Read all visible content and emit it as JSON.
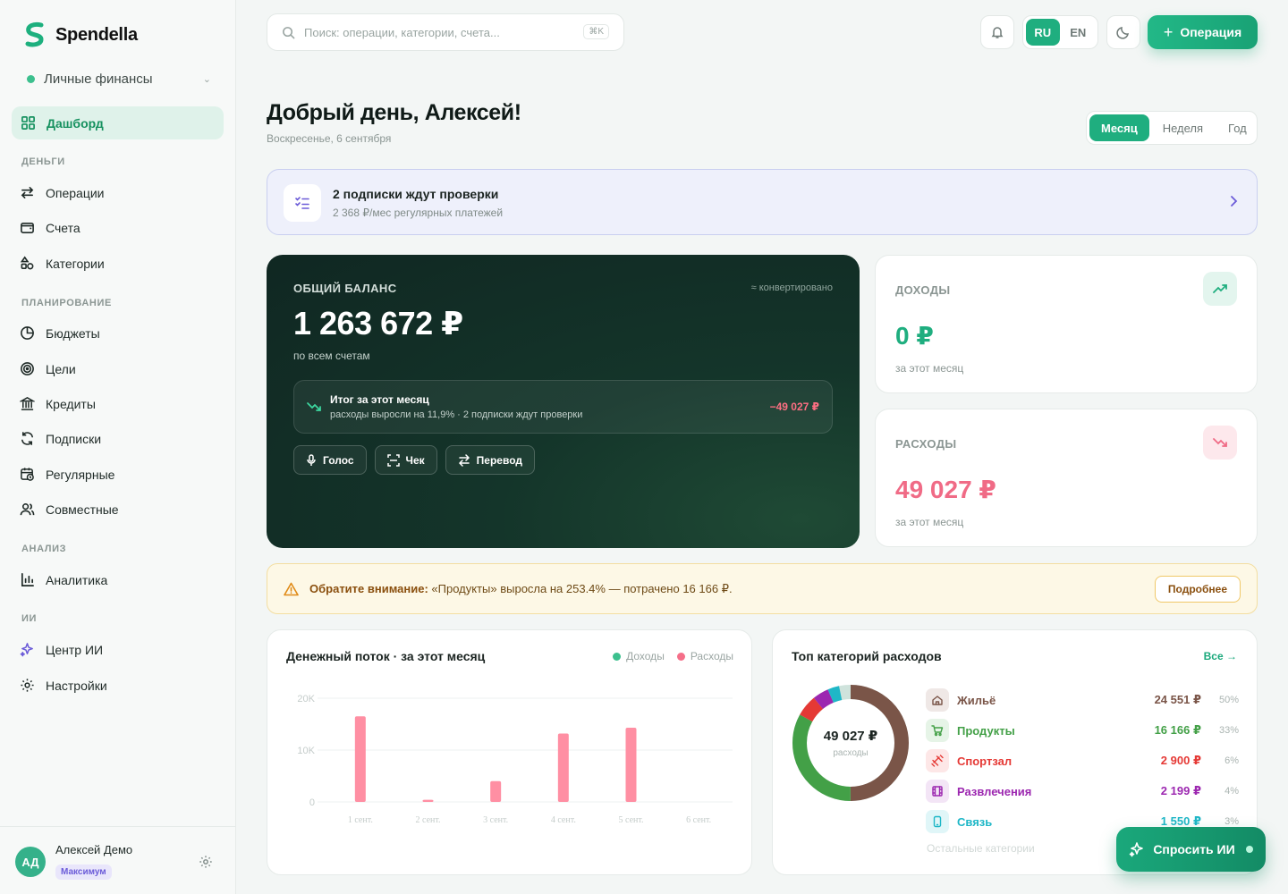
{
  "app": {
    "name": "Spendella",
    "brand_color": "#1fae7f"
  },
  "workspace": {
    "label": "Личные финансы"
  },
  "nav": {
    "dashboard": "Дашборд",
    "sections": {
      "money": "ДЕНЬГИ",
      "planning": "ПЛАНИРОВАНИЕ",
      "analysis": "АНАЛИЗ",
      "ai": "ИИ"
    },
    "items": {
      "operations": "Операции",
      "accounts": "Счета",
      "categories": "Категории",
      "budgets": "Бюджеты",
      "goals": "Цели",
      "credits": "Кредиты",
      "subscriptions": "Подписки",
      "recurring": "Регулярные",
      "shared": "Совместные",
      "analytics": "Аналитика",
      "ai_center": "Центр ИИ",
      "settings": "Настройки"
    }
  },
  "user": {
    "initials": "АД",
    "name": "Алексей Демо",
    "plan": "Максимум"
  },
  "topbar": {
    "search_placeholder": "Поиск: операции, категории, счета...",
    "search_shortcut": "⌘K",
    "lang_ru": "RU",
    "lang_en": "EN",
    "operation_button": "Операция"
  },
  "greeting": {
    "title": "Добрый день, Алексей!",
    "date": "Воскресенье, 6 сентября"
  },
  "period": {
    "month": "Месяц",
    "week": "Неделя",
    "year": "Год",
    "selected": "month"
  },
  "subs_banner": {
    "title": "2 подписки ждут проверки",
    "subtitle": "2 368 ₽/мес регулярных платежей"
  },
  "balance": {
    "label": "ОБЩИЙ БАЛАНС",
    "converted": "≈ конвертировано",
    "value": "1 263 672 ₽",
    "subtitle": "по всем счетам",
    "month_title": "Итог за этот месяц",
    "month_subtitle": "расходы выросли на 11,9% · 2 подписки ждут проверки",
    "month_value": "−49 027 ₽",
    "actions": {
      "voice": "Голос",
      "receipt": "Чек",
      "transfer": "Перевод"
    }
  },
  "income": {
    "label": "ДОХОДЫ",
    "value": "0 ₽",
    "subtitle": "за этот месяц",
    "color": "#1fae7f"
  },
  "expenses": {
    "label": "РАСХОДЫ",
    "value": "49 027 ₽",
    "subtitle": "за этот месяц",
    "color": "#f06b86"
  },
  "alert": {
    "bold": "Обратите внимание:",
    "text": " «Продукты» выросла на 253.4% — потрачено 16 166 ₽.",
    "button": "Подробнее"
  },
  "cashflow": {
    "title": "Денежный поток · за этот месяц",
    "legend_income": "Доходы",
    "legend_expense": "Расходы",
    "income_color": "#3cc08e",
    "expense_color": "#f56f89"
  },
  "chart_data": {
    "type": "bar",
    "title": "Денежный поток · за этот месяц",
    "x": [
      "1 сент.",
      "1.5",
      "2 сент.",
      "2.5",
      "3 сент.",
      "3.5",
      "4 сент.",
      "4.5",
      "5 сент.",
      "5.5",
      "6 сент."
    ],
    "x_tick_labels": [
      "1 сент.",
      "2 сент.",
      "3 сент.",
      "4 сент.",
      "5 сент.",
      "6 сент."
    ],
    "y_tick_labels": [
      "20K",
      "10K",
      "0"
    ],
    "ylim": [
      0,
      20000
    ],
    "grid": true,
    "series": [
      {
        "name": "Расходы",
        "color": "#ff8fa3",
        "points": [
          [
            1,
            16500
          ],
          [
            2,
            400
          ],
          [
            3,
            4000
          ],
          [
            4,
            13200
          ],
          [
            5,
            14300
          ]
        ]
      },
      {
        "name": "Доходы",
        "color": "#3cc08e",
        "points": []
      }
    ]
  },
  "top_categories": {
    "title": "Топ категорий расходов",
    "all_link": "Все →",
    "total": "49 027 ₽",
    "total_label": "расходы",
    "more": "Остальные категории",
    "items": [
      {
        "name": "Жильё",
        "amount": "24 551 ₽",
        "pct": "50%",
        "share": 0.5,
        "color": "#7a5548",
        "bg": "#efe8e6",
        "icon": "home-icon"
      },
      {
        "name": "Продукты",
        "amount": "16 166 ₽",
        "pct": "33%",
        "share": 0.33,
        "color": "#43a047",
        "bg": "#e6f4e7",
        "icon": "cart-icon"
      },
      {
        "name": "Спортзал",
        "amount": "2 900 ₽",
        "pct": "6%",
        "share": 0.06,
        "color": "#e53935",
        "bg": "#fde7e7",
        "icon": "dumbbell-icon"
      },
      {
        "name": "Развлечения",
        "amount": "2 199 ₽",
        "pct": "4%",
        "share": 0.045,
        "color": "#9c27b0",
        "bg": "#f3e5f6",
        "icon": "film-icon"
      },
      {
        "name": "Связь",
        "amount": "1 550 ₽",
        "pct": "3%",
        "share": 0.032,
        "color": "#1fb7c7",
        "bg": "#e0f6f8",
        "icon": "phone-icon"
      }
    ],
    "rest_color": "#cfe3dc"
  },
  "ai_button": {
    "label": "Спросить ИИ"
  }
}
